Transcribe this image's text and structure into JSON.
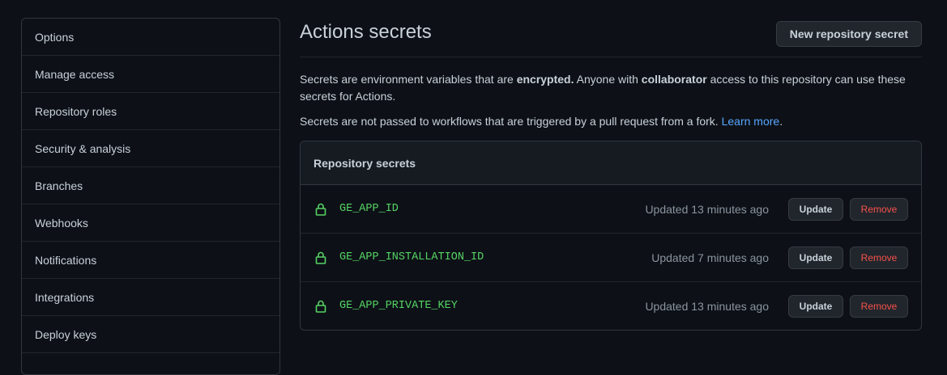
{
  "sidebar": {
    "items": [
      {
        "label": "Options"
      },
      {
        "label": "Manage access"
      },
      {
        "label": "Repository roles"
      },
      {
        "label": "Security & analysis"
      },
      {
        "label": "Branches"
      },
      {
        "label": "Webhooks"
      },
      {
        "label": "Notifications"
      },
      {
        "label": "Integrations"
      },
      {
        "label": "Deploy keys"
      }
    ]
  },
  "header": {
    "title": "Actions secrets",
    "new_button_label": "New repository secret"
  },
  "description": {
    "p1_a": "Secrets are environment variables that are ",
    "p1_b": "encrypted.",
    "p1_c": " Anyone with ",
    "p1_d": "collaborator",
    "p1_e": " access to this repository can use these secrets for Actions.",
    "p2_a": "Secrets are not passed to workflows that are triggered by a pull request from a fork. ",
    "p2_link": "Learn more",
    "p2_end": "."
  },
  "secrets_box": {
    "header": "Repository secrets",
    "update_label": "Update",
    "remove_label": "Remove",
    "rows": [
      {
        "name": "GE_APP_ID",
        "updated": "Updated 13 minutes ago"
      },
      {
        "name": "GE_APP_INSTALLATION_ID",
        "updated": "Updated 7 minutes ago"
      },
      {
        "name": "GE_APP_PRIVATE_KEY",
        "updated": "Updated 13 minutes ago"
      }
    ]
  },
  "colors": {
    "background": "#0d1117",
    "border": "#30363d",
    "text": "#c9d1d9",
    "muted": "#8b949e",
    "link": "#58a6ff",
    "secret_name": "#56d364",
    "danger": "#f85149"
  },
  "icons": {
    "lock": "lock-icon"
  }
}
